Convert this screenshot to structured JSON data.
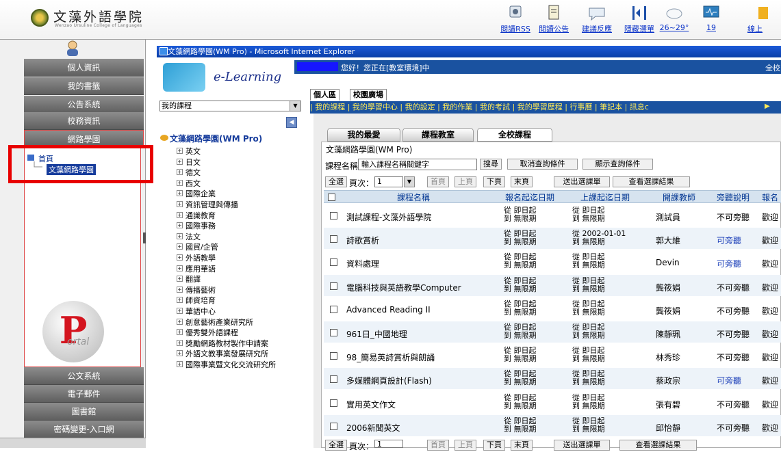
{
  "header": {
    "college_name": "文藻外語學院",
    "college_sub": "Wenzao Ursuline College of Languages",
    "toolbar": [
      {
        "icon": "rss-icon",
        "label": "閱讀RSS"
      },
      {
        "icon": "notice-icon",
        "label": "閱讀公告"
      },
      {
        "icon": "feedback-icon",
        "label": "建議反應"
      },
      {
        "icon": "hide-menu-icon",
        "label": "隱藏選單"
      },
      {
        "icon": "weather-icon",
        "label": "26~29°"
      },
      {
        "icon": "online-icon",
        "label": "19"
      },
      {
        "icon": "online-users-icon",
        "label": "線上"
      }
    ]
  },
  "sidebar": {
    "items_top": [
      "個人資訊",
      "我的書籤",
      "公告系統",
      "校務資訊",
      "網路學園"
    ],
    "tree_home": "首頁",
    "tree_child": "文藻網路學園",
    "items_bottom": [
      "公文系統",
      "電子郵件",
      "圖書館",
      "密碼變更-入口網"
    ],
    "portal_word": "ortal"
  },
  "window": {
    "title": "文藻網路學園(WM Pro) - Microsoft Internet Explorer"
  },
  "elearning": {
    "logo_text": "e-Learning",
    "greeting": "您好！您正在[教室環境]中",
    "whole_school_cut": "全校",
    "tabs": [
      "個人區",
      "校園廣場"
    ],
    "nav_links": "| 我的課程 | 我的學習中心 | 我的設定 | 我的作業 | 我的考試 | 我的學習歷程 | 行事曆 | 筆記本 | 訊息c",
    "course_select_value": "我的課程"
  },
  "tree": {
    "root": "文藻網路學園(WM Pro)",
    "nodes": [
      "英文",
      "日文",
      "德文",
      "西文",
      "國際企業",
      "資訊管理與傳播",
      "通識教育",
      "國際事務",
      "法文",
      "國貿/企管",
      "外語教學",
      "應用華語",
      "翻譯",
      "傳播藝術",
      "師資培育",
      "華語中心",
      "創意藝術產業研究所",
      "優秀雙外語課程",
      "獎勵網路教材製作申請案",
      "外語文教事業發展研究所",
      "國際事業暨文化交流研究所"
    ]
  },
  "main": {
    "tabs": [
      "我的最愛",
      "課程教室",
      "全校課程"
    ],
    "panel_title": "文藻網路學園(WM Pro)",
    "course_name_label": "課程名稱：",
    "keyword_value": "輸入課程名稱關鍵字",
    "search_btn": "搜尋",
    "cancel_btn": "取消查詢條件",
    "show_btn": "顯示查詢條件",
    "select_all_btn": "全選",
    "page_label": "頁次：",
    "page_value": "1",
    "first_btn": "首頁",
    "prev_btn": "上頁",
    "next_btn": "下頁",
    "last_btn": "末頁",
    "submit_btn": "送出選課單",
    "view_btn": "查看選課結果",
    "columns": [
      "課程名稱",
      "報名起迄日期",
      "上課起迄日期",
      "開課教師",
      "旁聽說明",
      "報名"
    ],
    "rows": [
      {
        "name": "測試課程-文藻外語學院",
        "enroll_from": "從 即日起",
        "enroll_to": "到 無限期",
        "class_from": "從 即日起",
        "class_to": "到 無限期",
        "teacher": "測試員",
        "audit": "不可旁聽",
        "audit_link": false,
        "status": "歡迎"
      },
      {
        "name": "詩歌賞析",
        "enroll_from": "從 即日起",
        "enroll_to": "到 無限期",
        "class_from": "從 2002-01-01",
        "class_to": "到 無限期",
        "teacher": "郭大維",
        "audit": "可旁聽",
        "audit_link": true,
        "status": "歡迎"
      },
      {
        "name": "資料處理",
        "enroll_from": "從 即日起",
        "enroll_to": "到 無限期",
        "class_from": "從 即日起",
        "class_to": "到 無限期",
        "teacher": "Devin",
        "audit": "可旁聽",
        "audit_link": true,
        "status": "歡迎"
      },
      {
        "name": "電腦科技與英語教學Computer",
        "enroll_from": "從 即日起",
        "enroll_to": "到 無限期",
        "class_from": "從 即日起",
        "class_to": "到 無限期",
        "teacher": "龔筱娟",
        "audit": "不可旁聽",
        "audit_link": false,
        "status": "歡迎"
      },
      {
        "name": "Advanced Reading II",
        "enroll_from": "從 即日起",
        "enroll_to": "到 無限期",
        "class_from": "從 即日起",
        "class_to": "到 無限期",
        "teacher": "龔筱娟",
        "audit": "不可旁聽",
        "audit_link": false,
        "status": "歡迎"
      },
      {
        "name": "961日_中國地理",
        "enroll_from": "從 即日起",
        "enroll_to": "到 無限期",
        "class_from": "從 即日起",
        "class_to": "到 無限期",
        "teacher": "陳靜珮",
        "audit": "不可旁聽",
        "audit_link": false,
        "status": "歡迎"
      },
      {
        "name": "98_簡易英詩賞析與朗誦",
        "enroll_from": "從 即日起",
        "enroll_to": "到 無限期",
        "class_from": "從 即日起",
        "class_to": "到 無限期",
        "teacher": "林秀珍",
        "audit": "不可旁聽",
        "audit_link": false,
        "status": "歡迎"
      },
      {
        "name": "多媒體網頁設計(Flash)",
        "enroll_from": "從 即日起",
        "enroll_to": "到 無限期",
        "class_from": "從 即日起",
        "class_to": "到 無限期",
        "teacher": "蔡政宗",
        "audit": "可旁聽",
        "audit_link": true,
        "status": "歡迎"
      },
      {
        "name": "實用英文作文",
        "enroll_from": "從 即日起",
        "enroll_to": "到 無限期",
        "class_from": "從 即日起",
        "class_to": "到 無限期",
        "teacher": "張有碧",
        "audit": "不可旁聽",
        "audit_link": false,
        "status": "歡迎"
      },
      {
        "name": "2006新聞英文",
        "enroll_from": "從 即日起",
        "enroll_to": "到 無限期",
        "class_from": "從 即日起",
        "class_to": "到 無限期",
        "teacher": "邱怡靜",
        "audit": "不可旁聽",
        "audit_link": false,
        "status": "歡迎"
      }
    ]
  },
  "colors": {
    "accent": "#1a52a0",
    "highlight_box": "#e80000",
    "link": "#1a3eb8"
  }
}
